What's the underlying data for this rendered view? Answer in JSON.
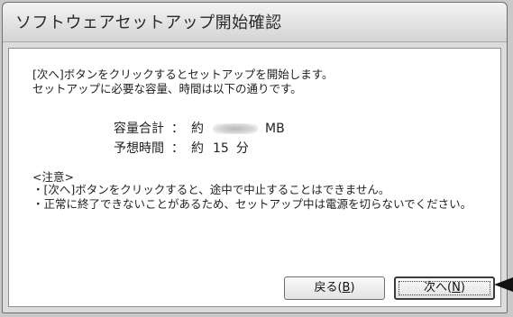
{
  "window": {
    "title": "ソフトウェアセットアップ開始確認"
  },
  "content": {
    "intro_line1": "[次へ]ボタンをクリックするとセットアップを開始します。",
    "intro_line2": "セットアップに必要な容量、時間は以下の通りです。",
    "capacity": {
      "label": "容量合計",
      "separator": "：",
      "approx": "約",
      "unit": "MB"
    },
    "time": {
      "label": "予想時間",
      "separator": "：",
      "approx": "約",
      "value": "15",
      "unit": "分"
    },
    "notes": {
      "heading": "<注意>",
      "item1": "・[次へ]ボタンをクリックすると、途中で中止することはできません。",
      "item2": "・正常に終了できないことがあるため、セットアップ中は電源を切らないでください。"
    }
  },
  "buttons": {
    "back_label": "戻る(",
    "back_key": "B",
    "back_close": ")",
    "next_label": "次へ(",
    "next_key": "N",
    "next_close": ")"
  }
}
